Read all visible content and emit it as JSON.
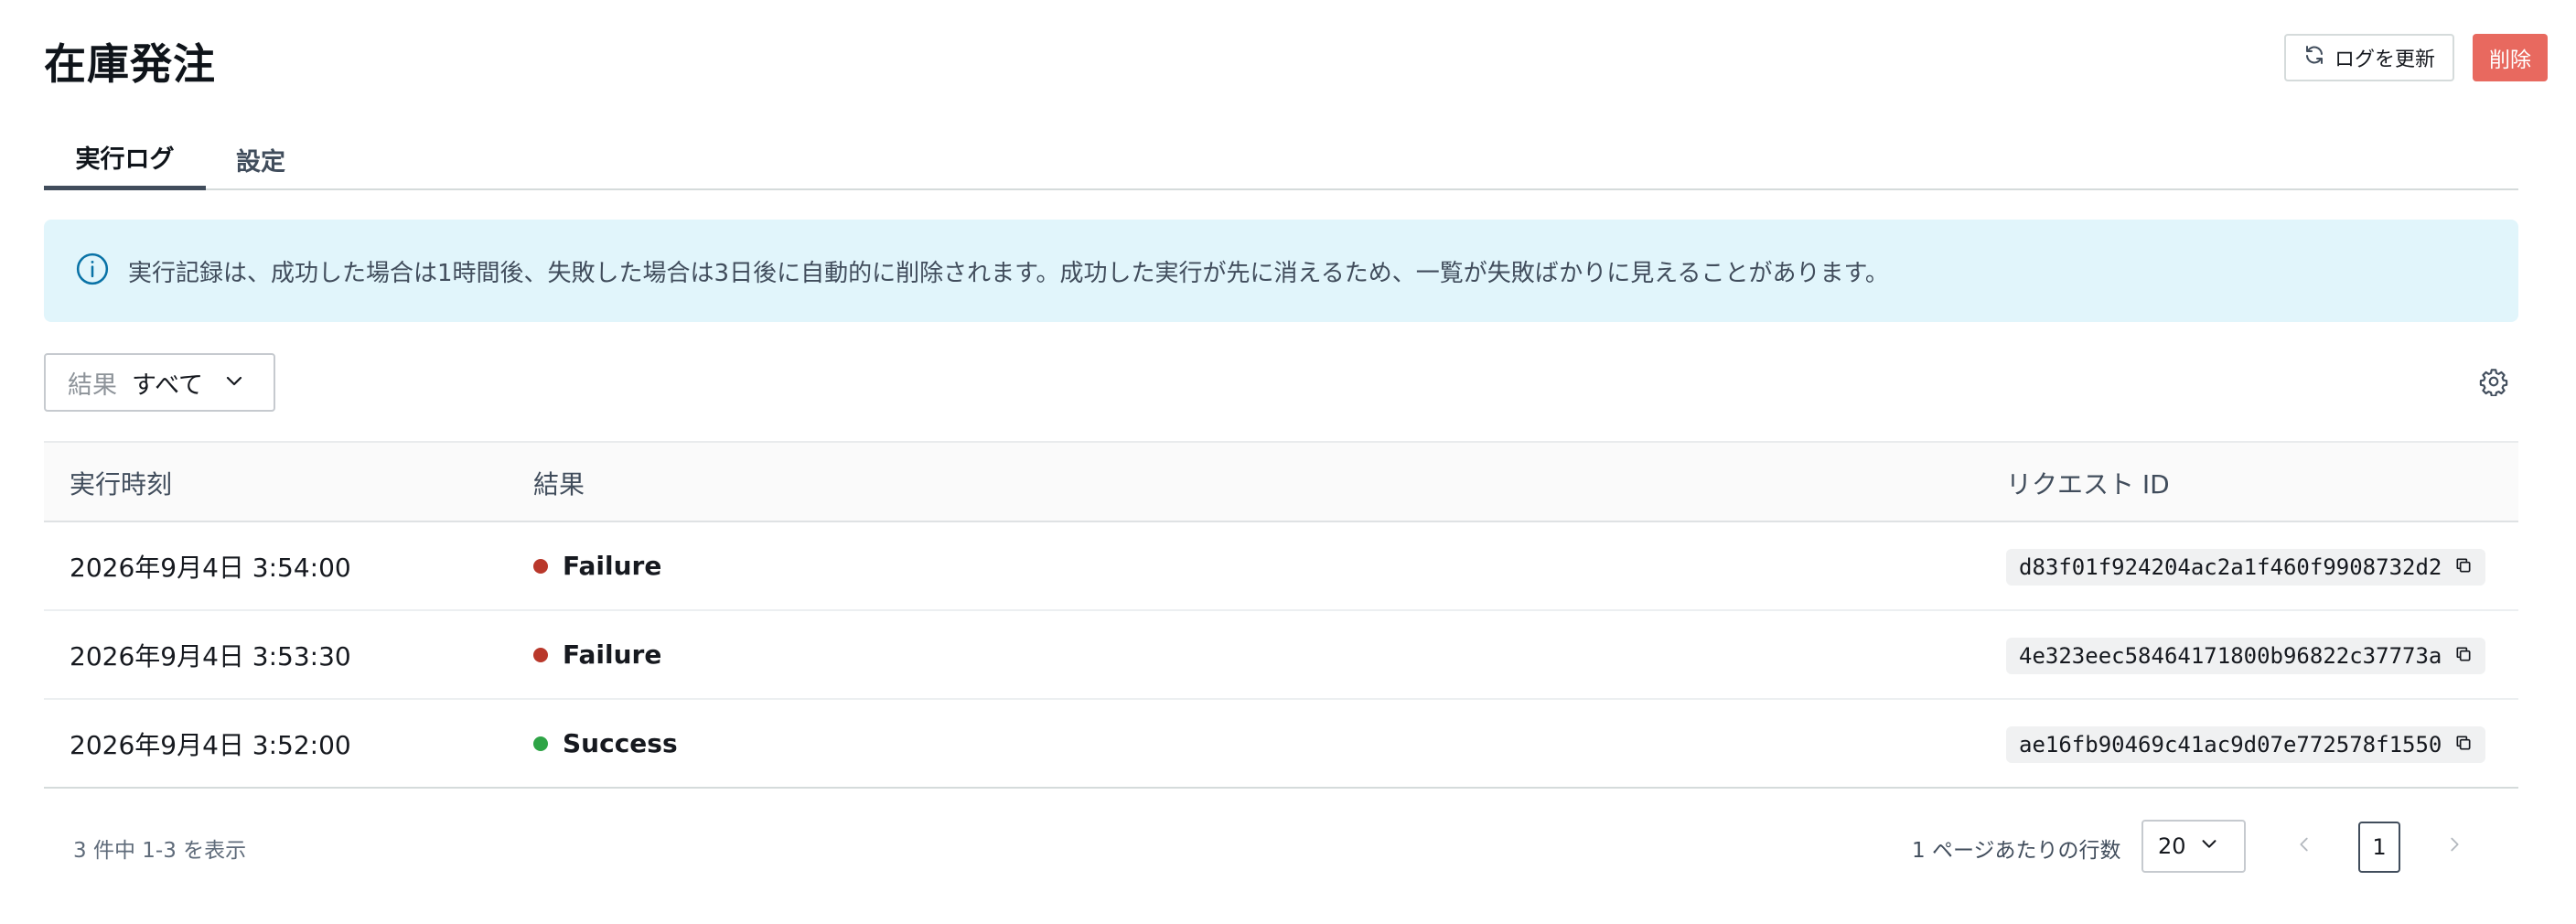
{
  "header": {
    "title": "在庫発注",
    "refresh_label": "ログを更新",
    "delete_label": "削除",
    "delete_color": "#e8695f"
  },
  "tabs": [
    {
      "label": "実行ログ",
      "selected": true
    },
    {
      "label": "設定",
      "selected": false
    }
  ],
  "info_banner": {
    "icon": "info-icon",
    "text": "実行記録は、成功した場合は1時間後、失敗した場合は3日後に自動的に削除されます。成功した実行が先に消えるため、一覧が失敗ばかりに見えることがあります。",
    "background": "#e1f5fb"
  },
  "filter": {
    "label": "結果",
    "value": "すべて"
  },
  "table": {
    "columns": [
      "実行時刻",
      "結果",
      "リクエスト ID"
    ],
    "rows": [
      {
        "time": "2026年9月4日 3:54:00",
        "status": "Failure",
        "status_color": "#b9382b",
        "request_id": "d83f01f924204ac2a1f460f9908732d2"
      },
      {
        "time": "2026年9月4日 3:53:30",
        "status": "Failure",
        "status_color": "#b9382b",
        "request_id": "4e323eec58464171800b96822c37773a"
      },
      {
        "time": "2026年9月4日 3:52:00",
        "status": "Success",
        "status_color": "#2ea446",
        "request_id": "ae16fb90469c41ac9d07e772578f1550"
      }
    ]
  },
  "footer": {
    "count_text": "3 件中 1-3 を表示",
    "rows_per_page_label": "1 ページあたりの行数",
    "rows_per_page_value": "20",
    "current_page": "1"
  }
}
